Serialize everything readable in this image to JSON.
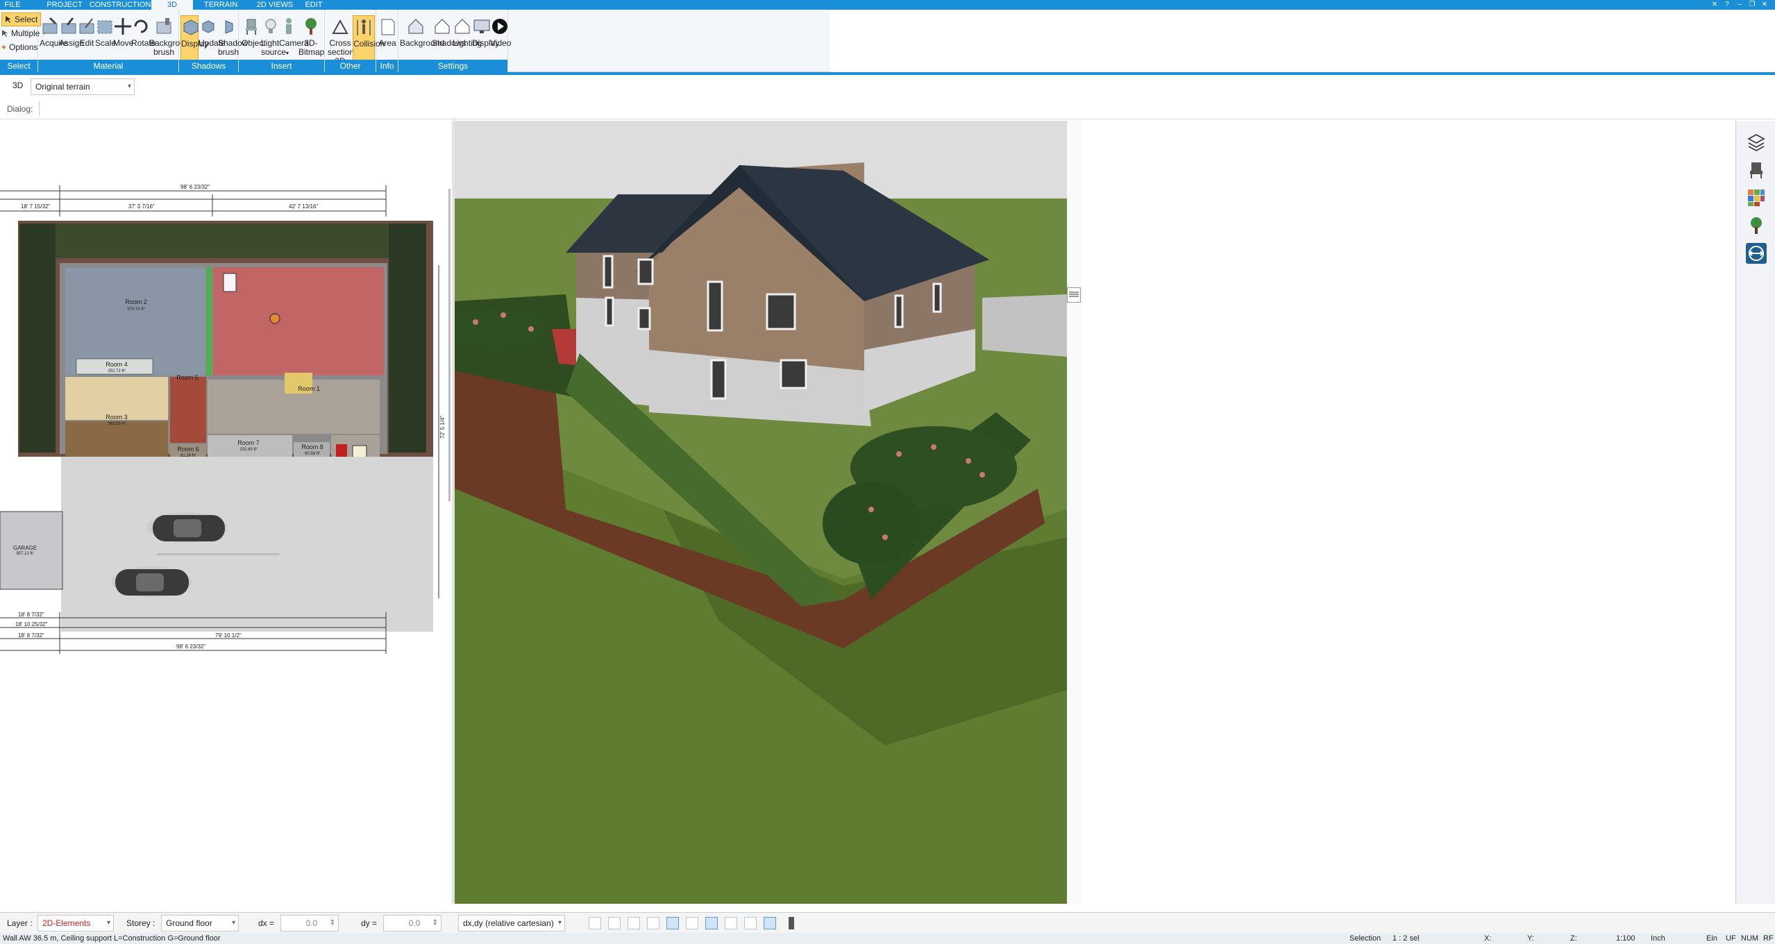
{
  "menu": {
    "tabs": [
      {
        "label": "FILE"
      },
      {
        "label": "PROJECT"
      },
      {
        "label": "CONSTRUCTION"
      },
      {
        "label": "3D"
      },
      {
        "label": "TERRAIN"
      },
      {
        "label": "2D VIEWS"
      },
      {
        "label": "EDIT"
      }
    ],
    "active_tab": "3D",
    "accent_color": "#1a8fd8",
    "active_color": "#fdd36b"
  },
  "ribbon": {
    "select": {
      "select": "Select",
      "multiple": "Multiple",
      "options": "Options",
      "group": "Select"
    },
    "material": {
      "acquire": "Acquire",
      "assign": "Assign",
      "edit": "Edit",
      "scale": "Scale",
      "move": "Move",
      "rotate": "Rotate",
      "background_brush_1": "Background",
      "background_brush_2": "brush",
      "group": "Material"
    },
    "shadows": {
      "display": "Display",
      "update": "Update",
      "shadow_brush_1": "Shadow",
      "shadow_brush_2": "brush",
      "group": "Shadows"
    },
    "insert": {
      "object": "Object",
      "light_1": "Light",
      "light_2": "source",
      "camera": "Camera",
      "bitmap": "3D-Bitmap",
      "group": "Insert"
    },
    "other": {
      "cross_1": "Cross",
      "cross_2": "section 3D",
      "collision": "Collision",
      "group": "Other"
    },
    "info": {
      "area": "Area",
      "group": "Info"
    },
    "settings": {
      "background": "Background",
      "shadows": "Shadows",
      "lighting": "Lighting",
      "display": "Display",
      "video": "Video",
      "group": "Settings"
    }
  },
  "toolbar": {
    "view_label": "3D",
    "terrain_value": "Original terrain",
    "dialog_label": "Dialog:"
  },
  "plan": {
    "rooms": [
      {
        "name": "Room 2",
        "area": "570.73 ft²"
      },
      {
        "name": "Room 4",
        "area": "252.73 ft²"
      },
      {
        "name": "Room 3",
        "area": "363.55 ft²"
      },
      {
        "name": "Room 1"
      },
      {
        "name": "Room 5"
      },
      {
        "name": "Room 6",
        "area": "81.26 ft²"
      },
      {
        "name": "Room 7",
        "area": "232.69 ft²"
      },
      {
        "name": "Room 8",
        "area": "90.58 ft²"
      },
      {
        "name": "GARAGE",
        "area": "957.13 ft²"
      }
    ],
    "dims": {
      "top_total": "98' 6 23/32\"",
      "top_left": "37' 3 7/16\"",
      "top_right": "42' 7 13/16\"",
      "top_far": "18' 7 15/32\"",
      "bottom_total": "98' 6 23/32\"",
      "bottom_mid": "79' 10 1/2\"",
      "bottom_left": "18' 8 7/32\"",
      "bottom_left2": "18' 10 25/32\"",
      "bottom_left3": "18' 8 7/32\"",
      "right_v": "72' 5 1/4\""
    }
  },
  "statusbar": {
    "layer_label": "Layer :",
    "layer_value": "2D-Elements",
    "storey_label": "Storey :",
    "storey_value": "Ground floor",
    "dx_label": "dx =",
    "dx_value": "0.0",
    "dy_label": "dy =",
    "dy_value": "0.0",
    "coord_mode": "dx,dy (relative cartesian)",
    "layer_color": "#d02020"
  },
  "infobar": {
    "message": "Wall AW 36.5 m, Ceiling support L=Construction G=Ground floor",
    "selection_label": "Selection",
    "selection_value": "1 : 2 sel",
    "x_label": "X:",
    "y_label": "Y:",
    "z_label": "Z:",
    "scale": "1:100",
    "unit": "Inch",
    "ein": "Ein",
    "caps": "UF",
    "num": "NUM",
    "rf": "RF"
  }
}
